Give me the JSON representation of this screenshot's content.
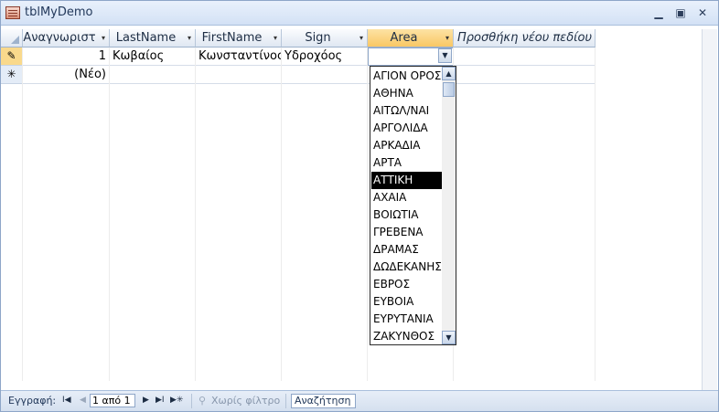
{
  "window": {
    "title": "tblMyDemo",
    "minimize_glyph": "▁",
    "maximize_glyph": "▣",
    "close_glyph": "✕"
  },
  "table": {
    "columns": [
      {
        "label": "Αναγνωριστ",
        "arrow": "▾"
      },
      {
        "label": "LastName",
        "arrow": "▾"
      },
      {
        "label": "FirstName",
        "arrow": "▾"
      },
      {
        "label": "Sign",
        "arrow": "▾"
      },
      {
        "label": "Area",
        "arrow": "▾"
      },
      {
        "label": "Προσθήκη νέου πεδίου"
      }
    ],
    "rows": [
      {
        "selector": "✎",
        "id": "1",
        "last_name": "Κωβαίος",
        "first_name": "Κωνσταντίνος",
        "sign": "Υδροχόος",
        "area": ""
      },
      {
        "selector": "✳",
        "id": "(Νέο)"
      }
    ]
  },
  "area_dropdown": {
    "selected": "ΑΤΤΙΚΗ",
    "button_glyph": "▼",
    "options": [
      "ΑΓΙΟΝ ΟΡΟΣ",
      "ΑΘΗΝΑ",
      "ΑΙΤΩΛ/ΝΑΙ",
      "ΑΡΓΟΛΙΔΑ",
      "ΑΡΚΑΔΙΑ",
      "ΑΡΤΑ",
      "ΑΤΤΙΚΗ",
      "ΑΧΑΙΑ",
      "ΒΟΙΩΤΙΑ",
      "ΓΡΕΒΕΝΑ",
      "ΔΡΑΜΑΣ",
      "ΔΩΔΕΚΑΝΗΣ",
      "ΕΒΡΟΣ",
      "ΕΥΒΟΙΑ",
      "ΕΥΡΥΤΑΝΙΑ",
      "ΖΑΚΥΝΘΟΣ"
    ],
    "scroll_up_glyph": "▲",
    "scroll_down_glyph": "▼"
  },
  "statusbar": {
    "record_label": "Εγγραφή:",
    "first_glyph": "I◀",
    "prev_glyph": "◀",
    "record_position": "1 από 1",
    "next_glyph": "▶",
    "last_glyph": "▶I",
    "new_glyph": "▶✳",
    "filter_icon_glyph": "⚲",
    "filter_label": "Χωρίς φίλτρο",
    "search_placeholder": "Αναζήτηση"
  }
}
